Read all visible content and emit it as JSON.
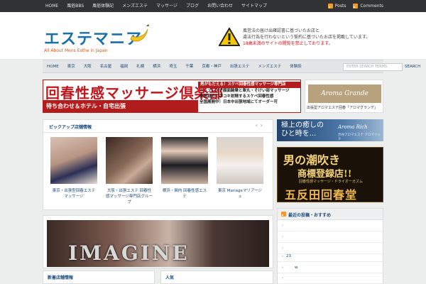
{
  "topbar": {
    "nav": [
      "HOME",
      "風俗BBS",
      "風俗体験記",
      "メンズエステ",
      "マッサージ",
      "ブログ",
      "お問い合わせ",
      "サイトマップ"
    ],
    "feeds": [
      {
        "label": "Posts",
        "icon": "rss-icon"
      },
      {
        "label": "Comments",
        "icon": "rss-icon"
      }
    ]
  },
  "header": {
    "logo_text": "エステマニア",
    "logo_tagline": "All About Mens Esthe in Japan",
    "warning_lines": [
      "風営法の届け出確認書に基づいたお店と",
      "違法行為を行わないという誓約に基づいたお店を掲載しています。"
    ],
    "warning_red": "18歳未満のサイトの閲覧を禁止しております。"
  },
  "mainnav": {
    "items": [
      "HOME",
      "東京",
      "大阪",
      "名古屋",
      "福岡",
      "札幌",
      "横浜",
      "埼玉",
      "千葉",
      "京都・神戸",
      "出張エステ",
      "メンズエステ",
      "体験談"
    ],
    "search_placeholder": "ENTER SEARCH TERMS",
    "search_button": "SEARCH"
  },
  "banner1": {
    "title": "回春性感マッサージ倶楽部",
    "strip": "待ち合わせ＆ホテル・自宅出張",
    "right_lines": [
      "男がもだえる！スケベ回春性感マッサージ専門店",
      "トップレスで顔面騎乗と睾丸・そけい部マッサージ",
      "乳首舐めで手コキ射精するスケベ回春性感",
      "全国展開中！日本中出張地域にてオーダー可"
    ]
  },
  "banner2": {
    "logo": "Aroma Grande",
    "caption": "出張型アロマエステ回春「アロマグランデ」"
  },
  "featured": {
    "title": "ピックアップ店舗情報",
    "cards": [
      {
        "caption": "東京・出張型回春エステ マッサージ"
      },
      {
        "caption": "大阪・出張エステ 回春性感マッサージ専門店グループ"
      },
      {
        "caption": "横浜・関内 回春性感エステ"
      },
      {
        "caption": "東京 Mariageマリアージュ"
      }
    ]
  },
  "imagine": {
    "word": "IMAGINE"
  },
  "bottom": [
    "新着店舗情報",
    "人気"
  ],
  "side1": {
    "line1": "極上の癒しの",
    "line2": "ひと時を...",
    "brand": "Aroma Rich",
    "sub": "渋谷アロマエステ アロマリッチ"
  },
  "side2": {
    "line1": "男の潮吹き",
    "line2": "商標登録店!!",
    "line3": "回春性感マッサージ・ドライオーガズム",
    "line4": "五反田回春堂"
  },
  "recent": {
    "title": "最近の投稿・おすすめ",
    "rows": [
      "",
      "",
      "",
      "23",
      "w",
      ""
    ]
  },
  "colors": {
    "topbar": "#303233",
    "accent_red": "#c0161c",
    "link_blue": "#1b4a7a",
    "logo_blue": "#1c70a8",
    "logo_orange": "#d85a24"
  }
}
